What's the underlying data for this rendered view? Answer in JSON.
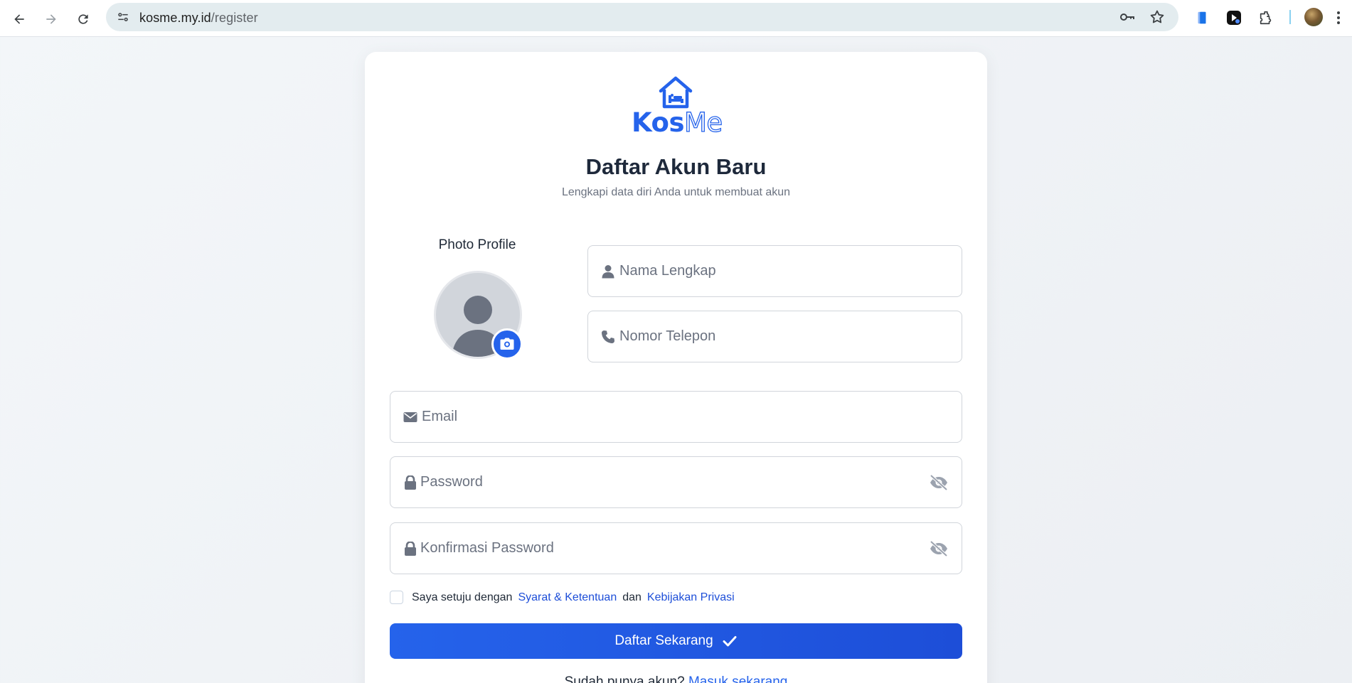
{
  "browser": {
    "url_host": "kosme.my.id",
    "url_path": "/register",
    "icons": [
      "back-icon",
      "forward-icon",
      "reload-icon",
      "site-info-icon",
      "password-key-icon",
      "bookmark-star-icon",
      "extension-icon",
      "extensions-puzzle-icon",
      "profile-avatar",
      "menu-icon"
    ]
  },
  "brand": {
    "name_part1": "Kos",
    "name_part2": "Me",
    "accent_color": "#2563eb"
  },
  "header": {
    "title": "Daftar Akun Baru",
    "subtitle": "Lengkapi data diri Anda untuk membuat akun"
  },
  "photo": {
    "label": "Photo Profile"
  },
  "form": {
    "full_name_placeholder": "Nama Lengkap",
    "phone_placeholder": "Nomor Telepon",
    "email_placeholder": "Email",
    "password_placeholder": "Password",
    "confirm_password_placeholder": "Konfirmasi Password"
  },
  "agreement": {
    "prefix": "Saya setuju dengan",
    "terms_link": "Syarat & Ketentuan",
    "joiner": "dan",
    "privacy_link": "Kebijakan Privasi",
    "checked": false
  },
  "submit_label": "Daftar Sekarang",
  "login_prompt": {
    "text": "Sudah punya akun?",
    "link": "Masuk sekarang"
  }
}
